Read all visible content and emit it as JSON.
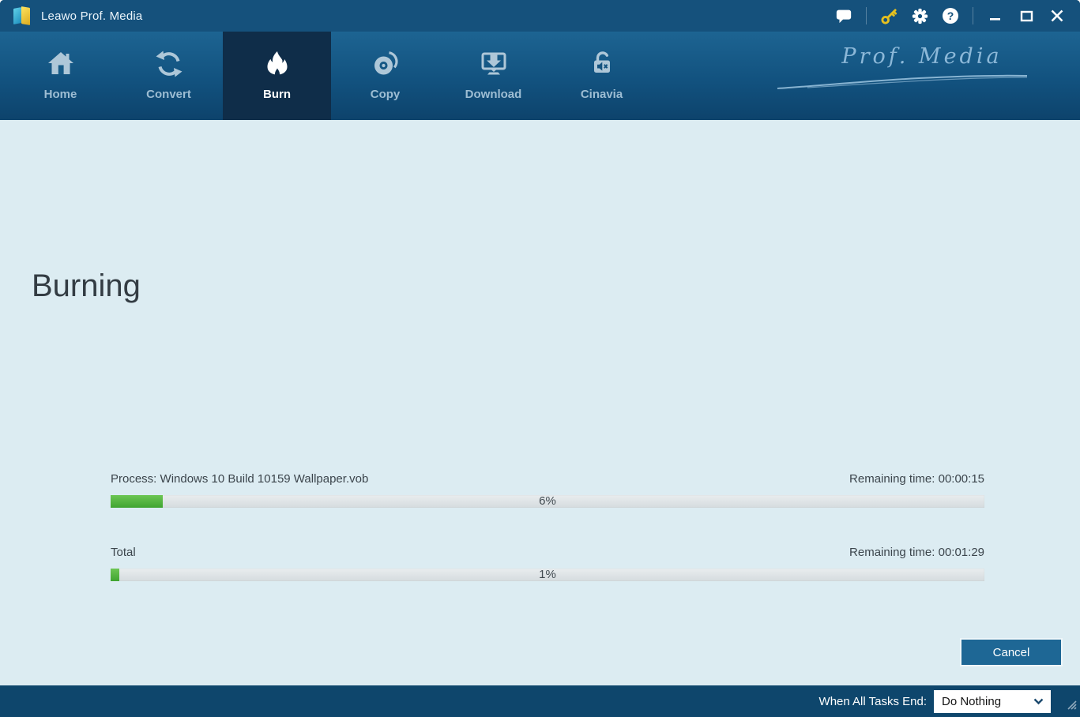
{
  "window": {
    "title": "Leawo Prof. Media"
  },
  "titlebar": {
    "icons": [
      "message-icon",
      "key-icon",
      "gear-icon",
      "help-icon",
      "minimize-icon",
      "maximize-icon",
      "close-icon"
    ]
  },
  "nav": {
    "tabs": [
      {
        "label": "Home",
        "icon": "home-icon",
        "active": false
      },
      {
        "label": "Convert",
        "icon": "convert-icon",
        "active": false
      },
      {
        "label": "Burn",
        "icon": "flame-icon",
        "active": true
      },
      {
        "label": "Copy",
        "icon": "disc-icon",
        "active": false
      },
      {
        "label": "Download",
        "icon": "download-icon",
        "active": false
      },
      {
        "label": "Cinavia",
        "icon": "cinavia-lock-icon",
        "active": false
      }
    ],
    "signature": "Prof. Media"
  },
  "main": {
    "heading": "Burning",
    "process": {
      "label": "Process:",
      "file": "Windows 10 Build 10159 Wallpaper.vob",
      "remaining_label": "Remaining time:",
      "remaining_time": "00:00:15",
      "percent_label": "6%",
      "percent_value": 6
    },
    "total": {
      "label": "Total",
      "remaining_label": "Remaining time:",
      "remaining_time": "00:01:29",
      "percent_label": "1%",
      "percent_value": 1
    },
    "cancel_label": "Cancel"
  },
  "footer": {
    "label": "When All Tasks End:",
    "selected_option": "Do Nothing"
  },
  "colors": {
    "titlebar": "#15517c",
    "nav_top": "#1d6492",
    "nav_bottom": "#0d436c",
    "active_tab": "#0f2d49",
    "content_bg": "#dcecf2",
    "progress_green": "#4fb33b",
    "button_blue": "#1e6795",
    "footer_bg": "#0e466c",
    "key_yellow": "#e6c01f"
  }
}
